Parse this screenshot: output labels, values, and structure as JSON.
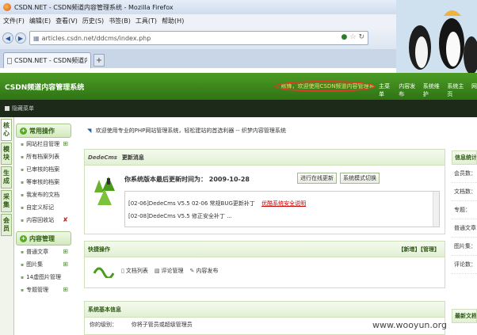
{
  "browser": {
    "window_title": "CSDN.NET - CSDN频道内容管理系统 - Mozilla Firefox",
    "menu": [
      "文件(F)",
      "编辑(E)",
      "查看(V)",
      "历史(S)",
      "书签(B)",
      "工具(T)",
      "帮助(H)"
    ],
    "url": "articles.csdn.net/ddcms/index.php",
    "search_placeholder": "百度",
    "tab_label": "CSDN.NET - CSDN频道内容管理系统",
    "tab_add": "+"
  },
  "app": {
    "title": "CSDN频道内容管理系统",
    "welcome": "您好：陈锋，欢迎使用CSDN频道内容管理系统！",
    "topnav": [
      "主菜单",
      "内容发布",
      "系统维护",
      "系统主页",
      "网"
    ],
    "subbar_label": "隐藏菜单"
  },
  "vtabs": [
    "核心",
    "模块",
    "生成",
    "采集",
    "会员"
  ],
  "menu": {
    "section1": "常用操作",
    "section1_items": [
      "网站栏目管理",
      "所有档案列表",
      "已审核的档案",
      "等审核的档案",
      "我发布的文档",
      "自定义标记",
      "内容回收站"
    ],
    "section2": "内容管理",
    "section2_items": [
      "普通文章",
      "图片集",
      "14虚图片管理",
      "专题管理"
    ]
  },
  "main": {
    "crumb": "欢迎使用专业的PHP网站管理系统，轻松建站的首选利器 -- 织梦内容管理系统",
    "update_panel": {
      "head": "DedeCms",
      "head_sub": "更新消息",
      "title_prefix": "你系统版本最后更新时间为：",
      "date": "2009-10-28",
      "btn_check": "进行在线更新",
      "btn_mode": "系统模式切换",
      "line1": "[02-06]DedeCms V5.5 02-06 常规BUG更新补丁",
      "line1_link": "优酷系统安全说明",
      "line2": "[02-08]DedeCms V5.5 修正安全补丁 ..."
    },
    "quick_panel": {
      "head": "快捷操作",
      "links": "【新增】【管理】",
      "items": [
        "文档列表",
        "评论管理",
        "内容发布"
      ]
    },
    "sysinfo_panel": {
      "head": "系统基本信息",
      "row": "你的级别：        你将子管员或超级管理员"
    }
  },
  "right": {
    "head": "信息统计",
    "rows": [
      "会员数：",
      "文档数：",
      "专题：",
      "普通文章：",
      "图片集：",
      "评论数："
    ],
    "head2": "最新文档"
  },
  "watermark": "www.wooyun.org"
}
